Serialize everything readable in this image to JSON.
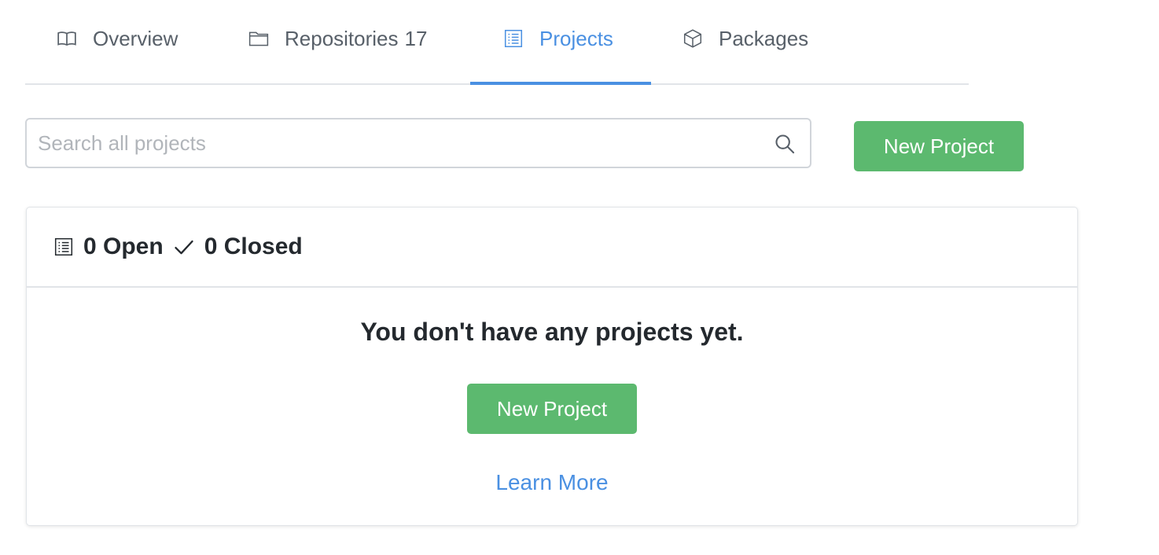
{
  "tabs": [
    {
      "label": "Overview",
      "count": "",
      "icon": "book-icon",
      "active": false
    },
    {
      "label": "Repositories",
      "count": "17",
      "icon": "folder-icon",
      "active": false
    },
    {
      "label": "Projects",
      "count": "",
      "icon": "project-list-icon",
      "active": true
    },
    {
      "label": "Packages",
      "count": "",
      "icon": "package-icon",
      "active": false
    }
  ],
  "search": {
    "placeholder": "Search all projects",
    "value": ""
  },
  "toolbar": {
    "new_project_label": "New Project"
  },
  "projects_card": {
    "open_count": "0 Open",
    "closed_count": "0 Closed",
    "empty_message": "You don't have any projects yet.",
    "new_project_label": "New Project",
    "learn_more_label": "Learn More"
  },
  "colors": {
    "accent": "#4a90e2",
    "primary_button": "#5cb96f",
    "text": "#24292e",
    "muted_text": "#586069"
  }
}
